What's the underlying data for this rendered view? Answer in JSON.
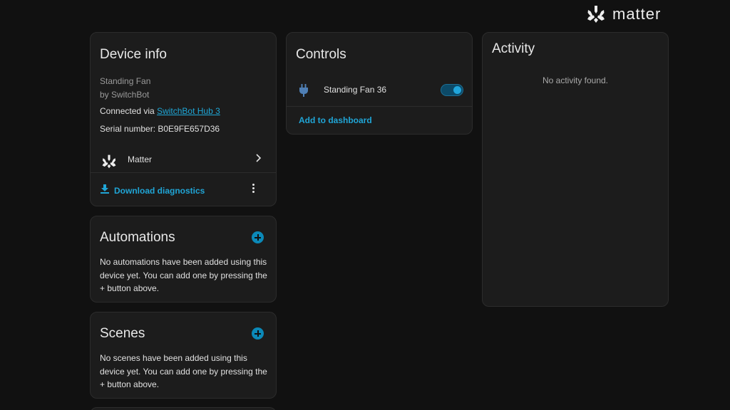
{
  "header": {
    "brand": "matter",
    "logo_icon": "matter-logo-icon"
  },
  "device_info": {
    "title": "Device info",
    "model": "Standing Fan",
    "manufacturer": "by SwitchBot",
    "connected_prefix": "Connected via",
    "connected_link": "SwitchBot Hub 3",
    "serial": "Serial number: B0E9FE657D36",
    "integration": {
      "label": "Matter",
      "icon": "matter-logo-icon"
    },
    "download_label": "Download diagnostics",
    "download_icon": "download-icon",
    "menu_icon": "more-vertical-icon"
  },
  "automations": {
    "title": "Automations",
    "text": "No automations have been added using this device yet. You can add one by pressing the + button above."
  },
  "scenes": {
    "title": "Scenes",
    "text": "No scenes have been added using this device yet. You can add one by pressing the + button above."
  },
  "controls": {
    "title": "Controls",
    "entity": {
      "label": "Standing Fan 36",
      "icon": "power-plug-icon",
      "state": "on"
    },
    "add_to_dashboard": "Add to dashboard"
  },
  "activity": {
    "title": "Activity",
    "empty": "No activity found."
  },
  "colors": {
    "accent": "#20a5d6",
    "background": "#111111",
    "card": "#1c1c1c"
  }
}
